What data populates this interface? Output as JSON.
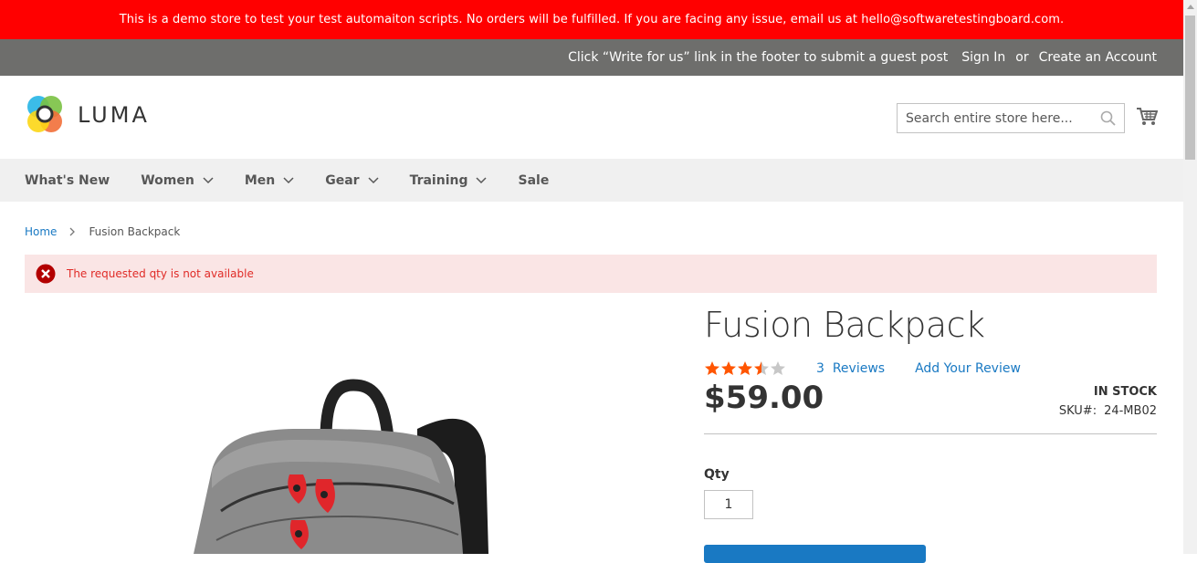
{
  "demo_notice": "This is a demo store to test your test automaiton scripts. No orders will be fulfilled. If you are facing any issue, email us at hello@softwaretestingboard.com.",
  "panel": {
    "guest_post": "Click “Write for us” link in the footer to submit a guest post",
    "sign_in": "Sign In",
    "or": "or",
    "create_account": "Create an Account"
  },
  "header": {
    "logo_text": "LUMA",
    "search_placeholder": "Search entire store here...",
    "search_icon": "search-icon",
    "cart_icon": "cart-icon"
  },
  "nav": {
    "items": [
      {
        "label": "What's New",
        "dropdown": false
      },
      {
        "label": "Women",
        "dropdown": true
      },
      {
        "label": "Men",
        "dropdown": true
      },
      {
        "label": "Gear",
        "dropdown": true
      },
      {
        "label": "Training",
        "dropdown": true
      },
      {
        "label": "Sale",
        "dropdown": false
      }
    ]
  },
  "breadcrumbs": {
    "home": "Home",
    "current": "Fusion Backpack"
  },
  "message": {
    "type": "error",
    "text": "The requested qty is not available"
  },
  "product": {
    "name": "Fusion Backpack",
    "rating_stars": 3.5,
    "rating_max": 5,
    "reviews_count": "3",
    "reviews_label": "Reviews",
    "add_review": "Add Your Review",
    "price": "$59.00",
    "stock": "IN STOCK",
    "sku_label": "SKU#:",
    "sku": "24-MB02",
    "qty_label": "Qty",
    "qty_value": "1"
  },
  "colors": {
    "demo_bar": "#ff0000",
    "panel": "#6e6e6c",
    "link": "#1979c3",
    "star": "#ff5501",
    "error_bg": "#fae5e5",
    "error_text": "#e02b27"
  }
}
